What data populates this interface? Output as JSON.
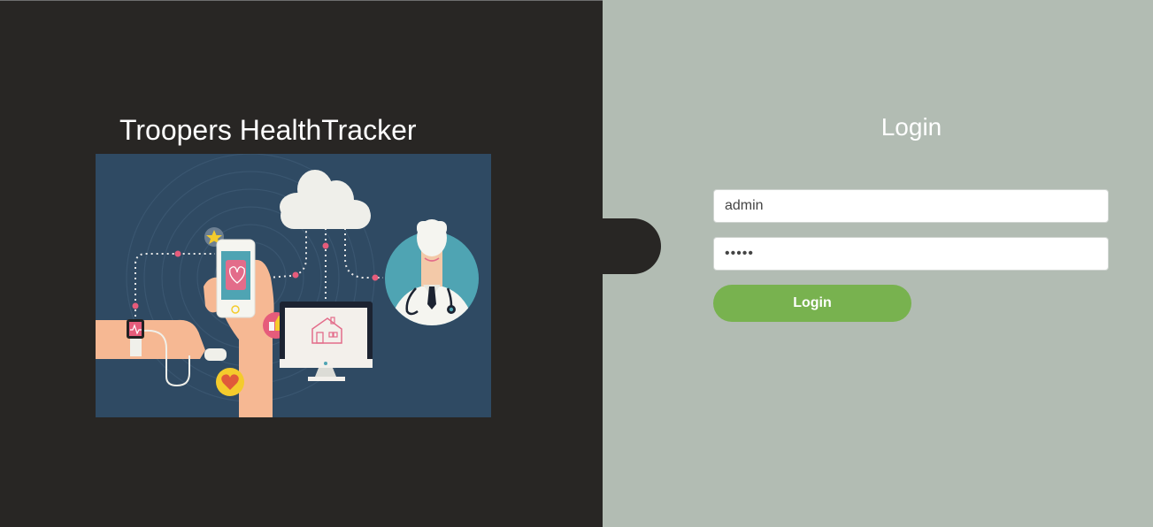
{
  "brand": {
    "title": "Troopers HealthTracker"
  },
  "hero_image": {
    "icon": "health-tracking-illustration"
  },
  "login": {
    "title": "Login",
    "username_value": "admin",
    "password_value": "admin",
    "button_label": "Login"
  },
  "colors": {
    "left_panel": "#282624",
    "right_panel": "#b2bcb3",
    "button": "#78b24f",
    "hero_background": "#2f4a63"
  }
}
